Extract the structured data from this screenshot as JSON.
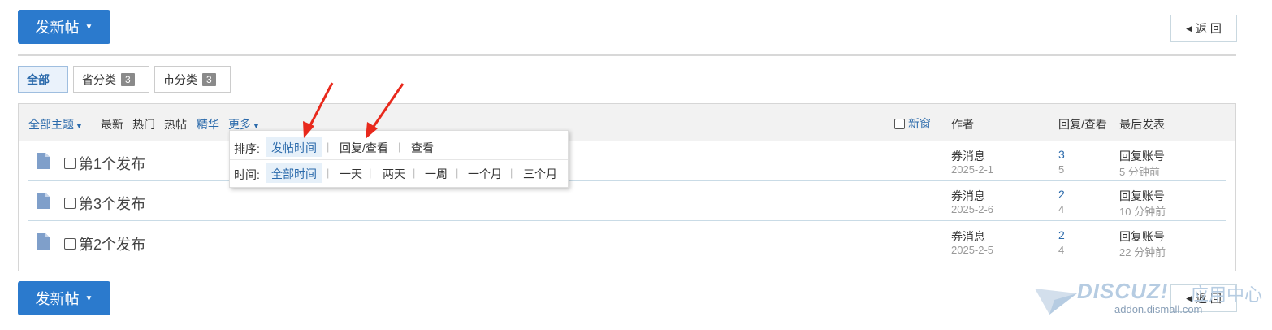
{
  "top": {
    "post_button": "发新帖",
    "back_button": "返 回"
  },
  "categories": [
    {
      "label": "全部",
      "count": null,
      "active": true
    },
    {
      "label": "省分类",
      "count": "3",
      "active": false
    },
    {
      "label": "市分类",
      "count": "3",
      "active": false
    }
  ],
  "filters": {
    "all_topics": "全部主题",
    "latest": "最新",
    "hot": "热门",
    "hot_posts": "热帖",
    "digest": "精华",
    "more": "更多"
  },
  "header_cols": {
    "new_window": "新窗",
    "author": "作者",
    "replies_views": "回复/查看",
    "last_post": "最后发表"
  },
  "threads": [
    {
      "title": "第1个发布",
      "author": "券消息",
      "date": "2025-2-1",
      "replies": "3",
      "views": "5",
      "last_by": "回复账号",
      "last_time": "5 分钟前"
    },
    {
      "title": "第3个发布",
      "author": "券消息",
      "date": "2025-2-6",
      "replies": "2",
      "views": "4",
      "last_by": "回复账号",
      "last_time": "10 分钟前"
    },
    {
      "title": "第2个发布",
      "author": "券消息",
      "date": "2025-2-5",
      "replies": "2",
      "views": "4",
      "last_by": "回复账号",
      "last_time": "22 分钟前"
    }
  ],
  "popup": {
    "sort_label": "排序:",
    "sort_options": [
      "发帖时间",
      "回复/查看",
      "查看"
    ],
    "time_label": "时间:",
    "time_options": [
      "全部时间",
      "一天",
      "两天",
      "一周",
      "一个月",
      "三个月"
    ]
  },
  "bottom": {
    "post_button": "发新帖",
    "back_button": "返 回"
  },
  "watermark": {
    "logo": "DISCUZ!",
    "cn": "应用中心",
    "url": "addon.dismall.com"
  },
  "colors": {
    "primary": "#2b7acd",
    "link": "#2b6aab",
    "annotation_arrow": "#e8291c"
  }
}
